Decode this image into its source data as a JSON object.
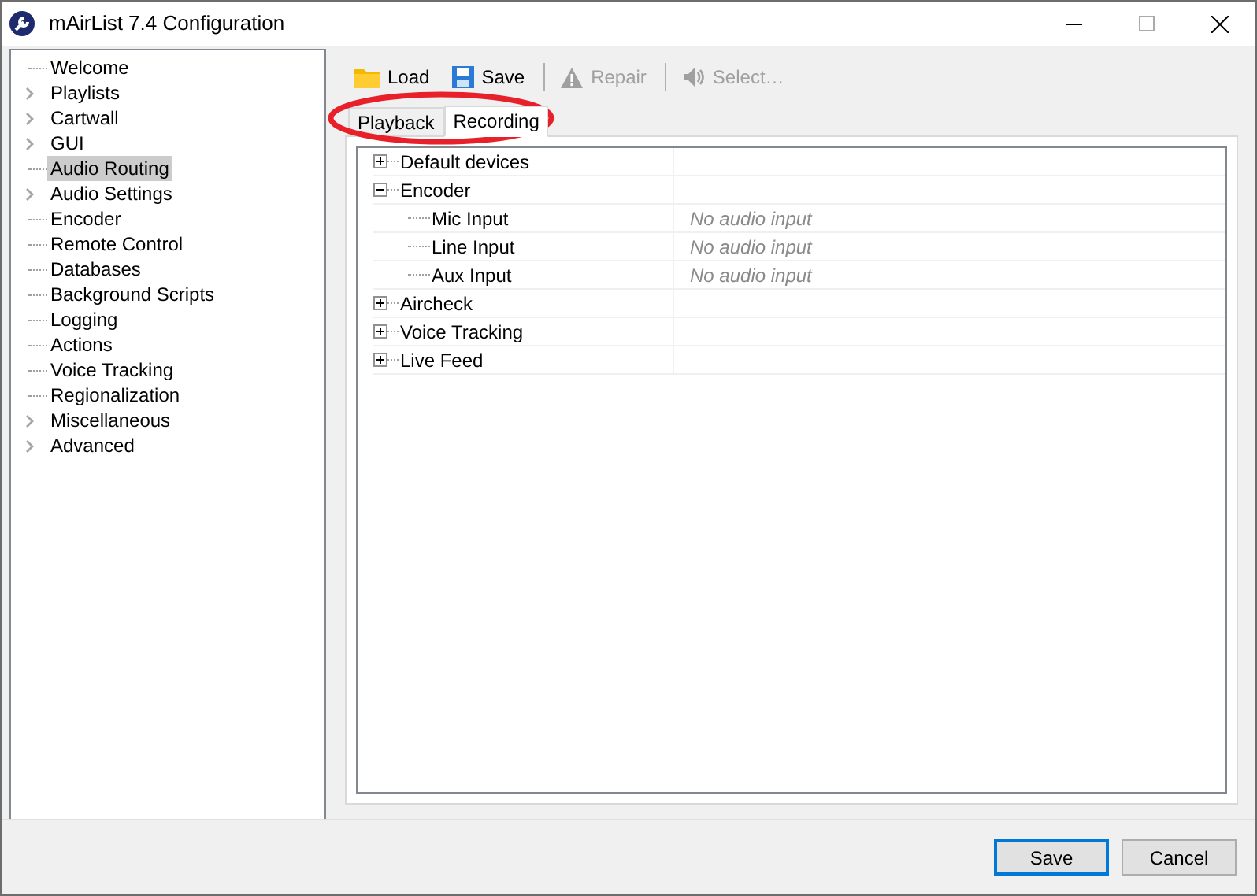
{
  "window": {
    "title": "mAirList 7.4 Configuration"
  },
  "sidebar": {
    "items": [
      {
        "label": "Welcome",
        "expandable": false,
        "selected": false
      },
      {
        "label": "Playlists",
        "expandable": true,
        "selected": false
      },
      {
        "label": "Cartwall",
        "expandable": true,
        "selected": false
      },
      {
        "label": "GUI",
        "expandable": true,
        "selected": false
      },
      {
        "label": "Audio Routing",
        "expandable": false,
        "selected": true
      },
      {
        "label": "Audio Settings",
        "expandable": true,
        "selected": false
      },
      {
        "label": "Encoder",
        "expandable": false,
        "selected": false
      },
      {
        "label": "Remote Control",
        "expandable": false,
        "selected": false
      },
      {
        "label": "Databases",
        "expandable": false,
        "selected": false
      },
      {
        "label": "Background Scripts",
        "expandable": false,
        "selected": false
      },
      {
        "label": "Logging",
        "expandable": false,
        "selected": false
      },
      {
        "label": "Actions",
        "expandable": false,
        "selected": false
      },
      {
        "label": "Voice Tracking",
        "expandable": false,
        "selected": false
      },
      {
        "label": "Regionalization",
        "expandable": false,
        "selected": false
      },
      {
        "label": "Miscellaneous",
        "expandable": true,
        "selected": false
      },
      {
        "label": "Advanced",
        "expandable": true,
        "selected": false
      }
    ]
  },
  "toolbar": [
    {
      "kind": "load",
      "label": "Load",
      "disabled": false
    },
    {
      "kind": "save",
      "label": "Save",
      "disabled": false
    },
    {
      "kind": "repair",
      "label": "Repair",
      "disabled": true
    },
    {
      "kind": "select",
      "label": "Select…",
      "disabled": true
    }
  ],
  "tabs": [
    {
      "label": "Playback",
      "selected": false
    },
    {
      "label": "Recording",
      "selected": true
    }
  ],
  "tree": [
    {
      "label": "Default devices",
      "expanded": false
    },
    {
      "label": "Encoder",
      "expanded": true,
      "children": [
        {
          "label": "Mic Input",
          "value": "No audio input"
        },
        {
          "label": "Line Input",
          "value": "No audio input"
        },
        {
          "label": "Aux Input",
          "value": "No audio input"
        }
      ]
    },
    {
      "label": "Aircheck",
      "expanded": false
    },
    {
      "label": "Voice Tracking",
      "expanded": false
    },
    {
      "label": "Live Feed",
      "expanded": false
    }
  ],
  "buttons": [
    {
      "label": "Save",
      "default": true
    },
    {
      "label": "Cancel",
      "default": false
    }
  ]
}
